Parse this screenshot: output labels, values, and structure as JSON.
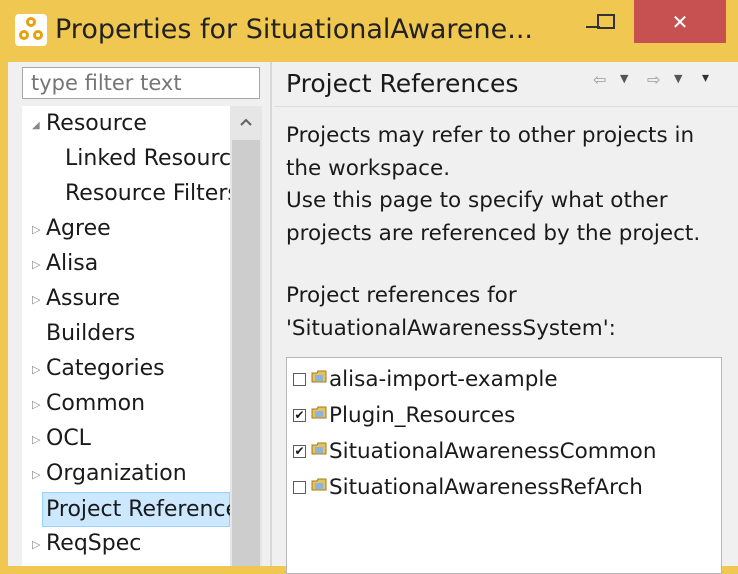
{
  "window": {
    "title": "Properties for SituationalAwarene..."
  },
  "filter": {
    "placeholder": "type filter text"
  },
  "tree": {
    "items": [
      {
        "label": "Resource",
        "arrow": "◢"
      },
      {
        "label": "Linked Resource",
        "arrow": ""
      },
      {
        "label": "Resource Filters",
        "arrow": ""
      },
      {
        "label": "Agree",
        "arrow": "▷"
      },
      {
        "label": "Alisa",
        "arrow": "▷"
      },
      {
        "label": "Assure",
        "arrow": "▷"
      },
      {
        "label": "Builders",
        "arrow": ""
      },
      {
        "label": "Categories",
        "arrow": "▷"
      },
      {
        "label": "Common",
        "arrow": "▷"
      },
      {
        "label": "OCL",
        "arrow": "▷"
      },
      {
        "label": "Organization",
        "arrow": "▷"
      },
      {
        "label": "Project Reference",
        "arrow": ""
      },
      {
        "label": "ReqSpec",
        "arrow": "▷"
      }
    ]
  },
  "page": {
    "title": "Project References",
    "desc1": "Projects may refer to other projects in",
    "desc2": "the workspace.",
    "desc3": "Use this page to specify what other",
    "desc4": "projects are referenced by the project.",
    "refs_label_1": "Project references for",
    "refs_label_2": "'SituationalAwarenessSystem':"
  },
  "references": [
    {
      "name": "alisa-import-example",
      "check": ""
    },
    {
      "name": "Plugin_Resources",
      "check": "✔"
    },
    {
      "name": "SituationalAwarenessCommon",
      "check": "✔"
    },
    {
      "name": "SituationalAwarenessRefArch",
      "check": ""
    }
  ],
  "nav": {
    "back": "⇦",
    "drop1": "▼",
    "forward": "⇨",
    "drop2": "▼",
    "menu": "▾"
  },
  "controls": {
    "close": "✕"
  },
  "colors": {
    "titlebar": "#f0c751",
    "close": "#c75050",
    "selection": "#cce8ff"
  }
}
